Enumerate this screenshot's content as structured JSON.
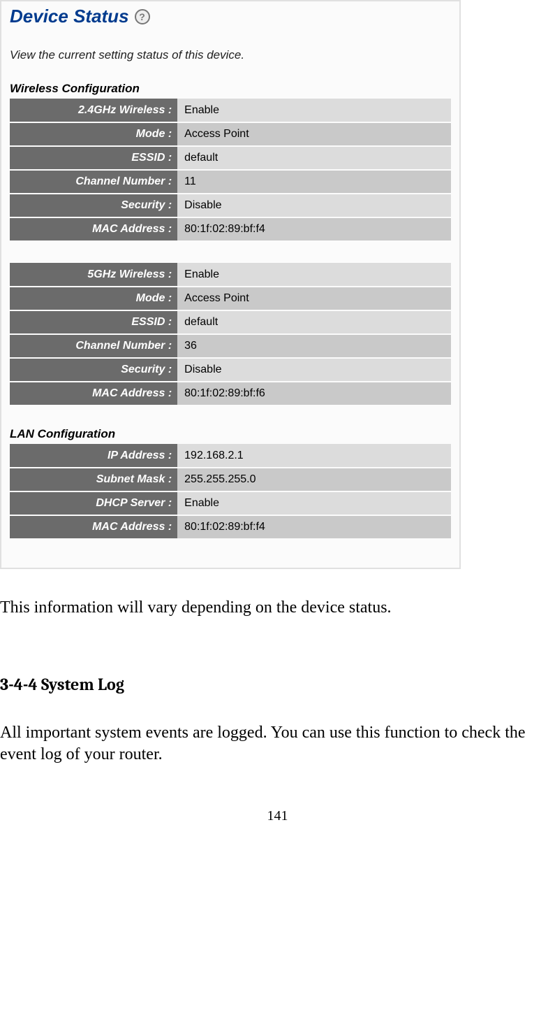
{
  "device_status": {
    "title": "Device Status",
    "subtitle": "View the current setting status of this device.",
    "wireless_heading": "Wireless Configuration",
    "wireless_24": [
      {
        "label": "2.4GHz Wireless :",
        "value": " Enable"
      },
      {
        "label": "Mode :",
        "value": "Access Point"
      },
      {
        "label": "ESSID :",
        "value": " default"
      },
      {
        "label": "Channel Number :",
        "value": "11"
      },
      {
        "label": "Security :",
        "value": "Disable"
      },
      {
        "label": "MAC Address :",
        "value": "80:1f:02:89:bf:f4"
      }
    ],
    "wireless_5": [
      {
        "label": "5GHz Wireless :",
        "value": "Enable"
      },
      {
        "label": "Mode :",
        "value": "Access Point"
      },
      {
        "label": "ESSID :",
        "value": " default"
      },
      {
        "label": "Channel Number :",
        "value": "36"
      },
      {
        "label": "Security :",
        "value": "Disable"
      },
      {
        "label": "MAC Address :",
        "value": "80:1f:02:89:bf:f6"
      }
    ],
    "lan_heading": "LAN Configuration",
    "lan": [
      {
        "label": "IP Address :",
        "value": "192.168.2.1"
      },
      {
        "label": "Subnet Mask :",
        "value": "255.255.255.0"
      },
      {
        "label": "DHCP Server :",
        "value": " Enable"
      },
      {
        "label": "MAC Address :",
        "value": "80:1f:02:89:bf:f4"
      }
    ]
  },
  "doc": {
    "paragraph1": "This information will vary depending on the device status.",
    "section_heading": "3-4-4 System Log",
    "paragraph2": "All important system events are logged. You can use this function to check the event log of your router.",
    "page_number": "141"
  }
}
